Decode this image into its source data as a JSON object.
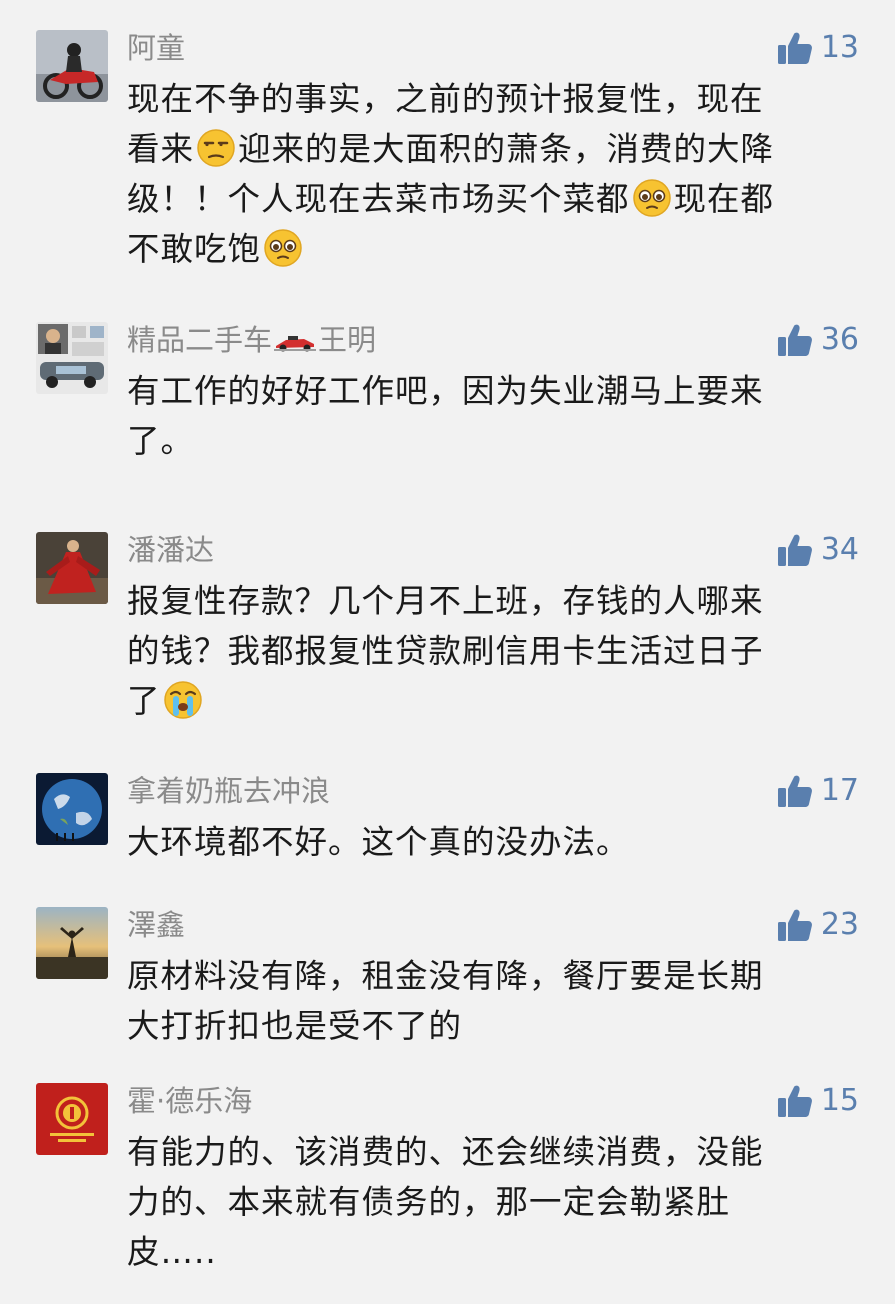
{
  "comments": [
    {
      "name": "阿童",
      "likes": "13",
      "avatar_icon": "motorcycle-rider-avatar",
      "lines": [
        [
          {
            "t": "现在不争的事实，之前的预计报复性，现在"
          }
        ],
        [
          {
            "t": "看来"
          },
          {
            "e": "unamused-emoji"
          },
          {
            "t": "迎来的是大面积的萧条，消费的大降"
          }
        ],
        [
          {
            "t": "级！！个人现在去菜市场买个菜都"
          },
          {
            "e": "pleading-emoji"
          },
          {
            "t": "现在都"
          }
        ],
        [
          {
            "t": "不敢吃饱"
          },
          {
            "e": "pleading-emoji"
          }
        ]
      ]
    },
    {
      "name_parts": [
        "精品二手车",
        "王明"
      ],
      "likes": "36",
      "avatar_icon": "car-collage-avatar",
      "lines": [
        [
          {
            "t": "有工作的好好工作吧，因为失业潮马上要来"
          }
        ],
        [
          {
            "t": "了。"
          }
        ]
      ]
    },
    {
      "name": "潘潘达",
      "likes": "34",
      "avatar_icon": "red-dress-avatar",
      "lines": [
        [
          {
            "t": "报复性存款？几个月不上班，存钱的人哪来"
          }
        ],
        [
          {
            "t": "的钱？我都报复性贷款刷信用卡生活过日子"
          }
        ],
        [
          {
            "t": "了"
          },
          {
            "e": "crying-emoji"
          }
        ]
      ]
    },
    {
      "name": "拿着奶瓶去冲浪",
      "likes": "17",
      "avatar_icon": "earth-avatar",
      "lines": [
        [
          {
            "t": "大环境都不好。这个真的没办法。"
          }
        ]
      ]
    },
    {
      "name": "澤鑫",
      "likes": "23",
      "avatar_icon": "sunset-avatar",
      "lines": [
        [
          {
            "t": "原材料没有降，租金没有降，餐厅要是长期"
          }
        ],
        [
          {
            "t": "大打折扣也是受不了的"
          }
        ]
      ]
    },
    {
      "name": "霍·德乐海",
      "likes": "15",
      "avatar_icon": "red-badge-avatar",
      "lines": [
        [
          {
            "t": "有能力的、该消费的、还会继续消费，没能"
          }
        ],
        [
          {
            "t": "力的、本来就有债务的，那一定会勒紧肚"
          }
        ],
        [
          {
            "t": "皮….."
          }
        ]
      ]
    }
  ],
  "colors": {
    "background": "#f2f2f2",
    "name": "#8a8a8a",
    "like": "#5a7fae",
    "text": "#1a1a1a"
  }
}
